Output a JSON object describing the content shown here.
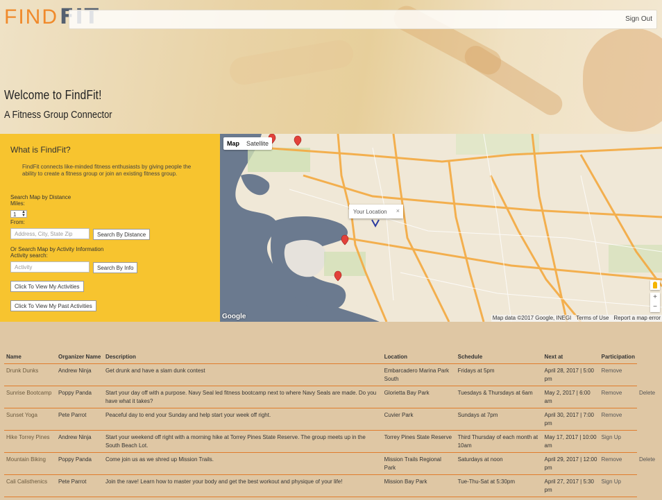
{
  "logo": {
    "find": "FIND",
    "fit": "FIT"
  },
  "header": {
    "sign_out": "Sign Out"
  },
  "hero": {
    "title": "Welcome to FindFit!",
    "subtitle": "A Fitness Group Connector"
  },
  "panel": {
    "title": "What is FindFit?",
    "description": "FindFit connects like-minded fitness enthusiasts by giving people the ability to create a fitness group or join an existing fitness group.",
    "distance_heading": "Search Map by Distance",
    "miles_label": "Miles:",
    "miles_value": "1",
    "from_label": "From:",
    "address_placeholder": "Address, City, State Zip",
    "search_distance_btn": "Search By Distance",
    "activity_heading": "Or Search Map by Activity Information",
    "activity_label": "Activity search:",
    "activity_placeholder": "Activity",
    "search_info_btn": "Search By Info",
    "my_activities_btn": "Click To View My Activities",
    "past_activities_btn": "Click To View My Past Activities"
  },
  "map": {
    "tab_map": "Map",
    "tab_satellite": "Satellite",
    "info_label": "Your Location",
    "google": "Google",
    "attribution": [
      "Map data ©2017 Google, INEGI",
      "Terms of Use",
      "Report a map error"
    ],
    "zoom_in": "+",
    "zoom_out": "−"
  },
  "table": {
    "headers": [
      "Name",
      "Organizer Name",
      "Description",
      "Location",
      "Schedule",
      "Next at",
      "Participation"
    ],
    "rows": [
      {
        "name": "Drunk Dunks",
        "organizer": "Andrew Ninja",
        "description": "Get drunk and have a slam dunk contest",
        "location": "Embarcadero Marina Park South",
        "schedule": "Fridays at 5pm",
        "next": "April 28, 2017 | 5:00 pm",
        "participation": "Remove",
        "extra": ""
      },
      {
        "name": "Sunrise Bootcamp",
        "organizer": "Poppy Panda",
        "description": "Start your day off with a purpose. Navy Seal led fitness bootcamp next to where Navy Seals are made. Do you have what it takes?",
        "location": "Glorietta Bay Park",
        "schedule": "Tuesdays & Thursdays at 6am",
        "next": "May 2, 2017 | 6:00 am",
        "participation": "Remove",
        "extra": "Delete"
      },
      {
        "name": "Sunset Yoga",
        "organizer": "Pete Parrot",
        "description": "Peaceful day to end your Sunday and help start your week off right.",
        "location": "Cuvier Park",
        "schedule": "Sundays at 7pm",
        "next": "April 30, 2017 | 7:00 pm",
        "participation": "Remove",
        "extra": ""
      },
      {
        "name": "Hike Torrey Pines",
        "organizer": "Andrew Ninja",
        "description": "Start your weekend off right with a morning hike at Torrey Pines State Reserve. The group meets up in the South Beach Lot.",
        "location": "Torrey Pines State Reserve",
        "schedule": "Third Thursday of each month at 10am",
        "next": "May 17, 2017 | 10:00 am",
        "participation": "Sign Up",
        "extra": ""
      },
      {
        "name": "Mountain Biking",
        "organizer": "Poppy Panda",
        "description": "Come join us as we shred up Mission Trails.",
        "location": "Mission Trails Regional Park",
        "schedule": "Saturdays at noon",
        "next": "April 29, 2017 | 12:00 pm",
        "participation": "Remove",
        "extra": "Delete"
      },
      {
        "name": "Cali Calisthenics",
        "organizer": "Pete Parrot",
        "description": "Join the rave! Learn how to master your body and get the best workout and physique of your life!",
        "location": "Mission Bay Park",
        "schedule": "Tue-Thu-Sat at 5:30pm",
        "next": "April 27, 2017 | 5:30 pm",
        "participation": "Sign Up",
        "extra": ""
      }
    ]
  },
  "colors": {
    "accent": "#f08a2b",
    "panel": "#f7c42f",
    "table_bg": "#dfc7a4",
    "row_line": "#e07c2c"
  }
}
